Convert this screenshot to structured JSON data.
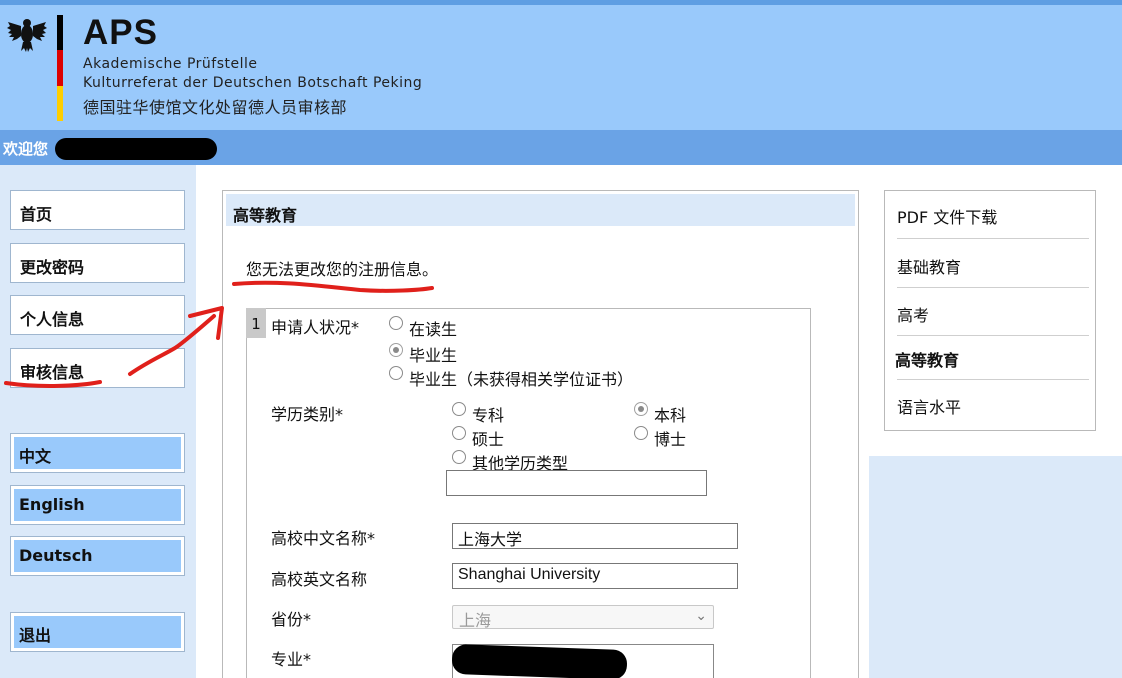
{
  "header": {
    "brand": "APS",
    "line1": "Akademische Prüfstelle",
    "line2": "Kulturreferat der Deutschen Botschaft Peking",
    "line3": "德国驻华使馆文化处留德人员审核部",
    "flag_colors": [
      "#000000",
      "#dd0000",
      "#ffce00"
    ]
  },
  "welcome": {
    "label": "欢迎您"
  },
  "leftnav": {
    "items": [
      {
        "label": "首页"
      },
      {
        "label": "更改密码"
      },
      {
        "label": "个人信息"
      },
      {
        "label": "审核信息"
      }
    ],
    "languages": [
      {
        "label": "中文"
      },
      {
        "label": "English"
      },
      {
        "label": "Deutsch"
      }
    ],
    "logout": "退出"
  },
  "main": {
    "section_title": "高等教育",
    "notice": "您无法更改您的注册信息。",
    "step": "1",
    "applicant_status": {
      "label": "申请人状况*",
      "options": [
        {
          "label": "在读生",
          "checked": false
        },
        {
          "label": "毕业生",
          "checked": true
        },
        {
          "label": "毕业生（未获得相关学位证书）",
          "checked": false
        }
      ]
    },
    "degree_type": {
      "label": "学历类别*",
      "options": [
        {
          "label": "专科",
          "checked": false
        },
        {
          "label": "本科",
          "checked": true
        },
        {
          "label": "硕士",
          "checked": false
        },
        {
          "label": "博士",
          "checked": false
        },
        {
          "label": "其他学历类型",
          "checked": false
        }
      ],
      "other_value": ""
    },
    "uni_cn": {
      "label": "高校中文名称*",
      "value": "上海大学"
    },
    "uni_en": {
      "label": "高校英文名称",
      "value": "Shanghai University"
    },
    "province": {
      "label": "省份*",
      "value": "上海"
    },
    "major": {
      "label": "专业*"
    }
  },
  "rightnav": {
    "items": [
      {
        "label": "PDF 文件下载",
        "active": false
      },
      {
        "label": "基础教育",
        "active": false
      },
      {
        "label": "高考",
        "active": false
      },
      {
        "label": "高等教育",
        "active": true
      },
      {
        "label": "语言水平",
        "active": false
      }
    ]
  },
  "colors": {
    "header_bg": "#99c9fb",
    "welcome_bar": "#6aa3e6",
    "page_bg": "#dbe9f9",
    "annotation_red": "#e0201b"
  }
}
